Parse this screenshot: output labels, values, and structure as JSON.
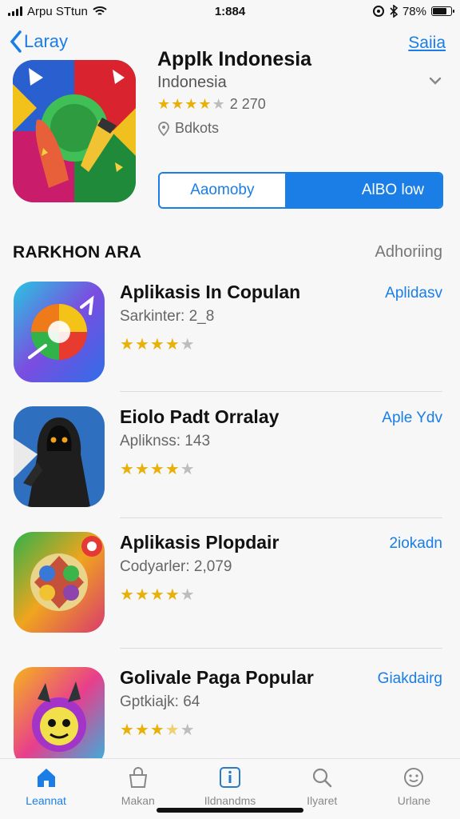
{
  "status": {
    "carrier": "Arpu STtun",
    "time": "1:884",
    "battery_percent": "78%",
    "battery_level": 0.78
  },
  "nav": {
    "back_label": "Laray",
    "right_label": "Saiia"
  },
  "app": {
    "title": "Applk Indonesia",
    "subtitle": "Indonesia",
    "rating_text": "2 270",
    "rating_stars": 4,
    "location": "Bdkots",
    "segment_left": "Aaomoby",
    "segment_right": "AlBO low"
  },
  "section": {
    "title": "RARKHON ARA",
    "action": "Adhoriing"
  },
  "list": [
    {
      "name": "Aplikasis In Copulan",
      "sub": "Sarkinter: 2_8",
      "stars": 4,
      "action": "Aplidasv",
      "icon": "chrome-swirl-icon"
    },
    {
      "name": "Eiolo Padt Orralay",
      "sub": "Apliknss: 143",
      "stars": 4,
      "action": "Aple Ydv",
      "icon": "hooded-figure-icon"
    },
    {
      "name": "Aplikasis Plopdair",
      "sub": "Codyarler: 2,079",
      "stars": 4,
      "action": "2iokadn",
      "icon": "game-pad-icon"
    },
    {
      "name": "Golivale Paga Popular",
      "sub": "Gptkiajk: 64",
      "stars": 3.5,
      "action": "Giakdairg",
      "icon": "monster-face-icon"
    }
  ],
  "tabs": [
    {
      "label": "Leannat",
      "icon": "home-icon",
      "active": true
    },
    {
      "label": "Makan",
      "icon": "bag-icon",
      "active": false
    },
    {
      "label": "Ildnandms",
      "icon": "info-square-icon",
      "active": false
    },
    {
      "label": "Ilyaret",
      "icon": "search-icon",
      "active": false
    },
    {
      "label": "Urlane",
      "icon": "smile-face-icon",
      "active": false
    }
  ],
  "colors": {
    "accent": "#1a7ee6",
    "star": "#e8b10a",
    "star_off": "#bdbdbd"
  }
}
